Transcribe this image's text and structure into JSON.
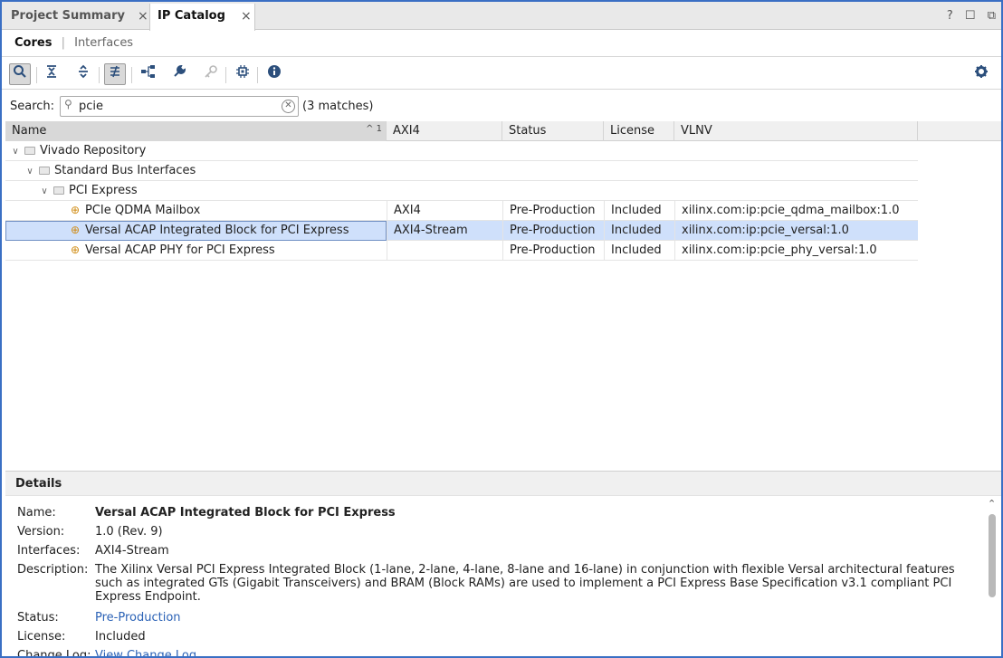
{
  "tabs": [
    {
      "label": "Project Summary",
      "close": "×"
    },
    {
      "label": "IP Catalog",
      "close": "×"
    }
  ],
  "window_icons": {
    "help": "?",
    "restore": "☐",
    "float": "⧉"
  },
  "subtabs": {
    "cores": "Cores",
    "separator": "|",
    "interfaces": "Interfaces"
  },
  "search": {
    "label": "Search:",
    "value": "pcie",
    "matches": "(3 matches)"
  },
  "columns": {
    "name": "Name",
    "sort_indicator": "^ 1",
    "axi4": "AXI4",
    "status": "Status",
    "license": "License",
    "vlnv": "VLNV"
  },
  "tree": {
    "repo": "Vivado Repository",
    "bus": "Standard Bus Interfaces",
    "pci": "PCI Express"
  },
  "rows": [
    {
      "name": "PCIe QDMA Mailbox",
      "axi": "AXI4",
      "status": "Pre-Production",
      "license": "Included",
      "vlnv": "xilinx.com:ip:pcie_qdma_mailbox:1.0"
    },
    {
      "name": "Versal ACAP Integrated Block for PCI Express",
      "axi": "AXI4-Stream",
      "status": "Pre-Production",
      "license": "Included",
      "vlnv": "xilinx.com:ip:pcie_versal:1.0"
    },
    {
      "name": "Versal ACAP PHY for PCI Express",
      "axi": "",
      "status": "Pre-Production",
      "license": "Included",
      "vlnv": "xilinx.com:ip:pcie_phy_versal:1.0"
    }
  ],
  "details": {
    "header": "Details",
    "name_label": "Name:",
    "name": "Versal ACAP Integrated Block for PCI Express",
    "version_label": "Version:",
    "version": "1.0 (Rev. 9)",
    "interfaces_label": "Interfaces:",
    "interfaces": "AXI4-Stream",
    "description_label": "Description:",
    "description": "The Xilinx Versal PCI Express Integrated Block (1-lane, 2-lane, 4-lane, 8-lane and 16-lane) in conjunction with flexible Versal architectural features such as integrated GTs (Gigabit Transceivers) and BRAM (Block RAMs) are used to implement a PCI Express Base Specification v3.1 compliant PCI Express Endpoint.",
    "status_label": "Status:",
    "status": "Pre-Production",
    "license_label": "License:",
    "license": "Included",
    "changelog_label": "Change Log:",
    "changelog": "View Change Log"
  }
}
